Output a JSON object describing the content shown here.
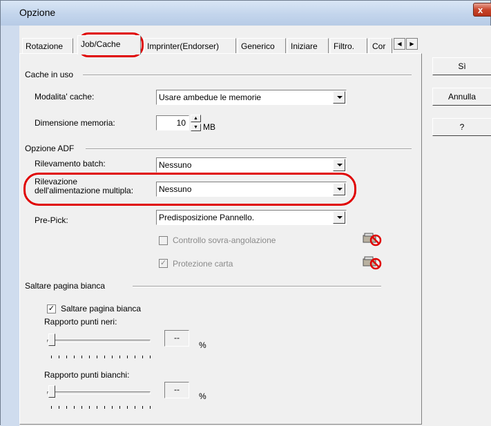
{
  "window": {
    "title": "Opzione",
    "close_label": "x"
  },
  "tabs": [
    {
      "label": "Rotazione"
    },
    {
      "label": "Job/Cache"
    },
    {
      "label": "Imprinter(Endorser)"
    },
    {
      "label": "Generico"
    },
    {
      "label": "Iniziare"
    },
    {
      "label": "Filtro."
    },
    {
      "label": "Cor"
    }
  ],
  "tab_scroll": {
    "left": "◀",
    "right": "▶"
  },
  "buttons": {
    "yes": "Sì",
    "cancel": "Annulla",
    "help": "?"
  },
  "cache": {
    "group_label": "Cache in uso",
    "mode_label": "Modalita' cache:",
    "mode_value": "Usare ambedue le memorie",
    "size_label": "Dimensione memoria:",
    "size_value": "10",
    "size_unit": "MB"
  },
  "adf": {
    "group_label": "Opzione ADF",
    "batch_label": "Rilevamento batch:",
    "batch_value": "Nessuno",
    "multifeed_label_1": "Rilevazione",
    "multifeed_label_2": "dell'alimentazione multipla:",
    "multifeed_value": "Nessuno",
    "prepick_label": "Pre-Pick:",
    "prepick_value": "Predisposizione Pannello.",
    "skew_label": "Controllo sovra-angolazione",
    "skew_checked": false,
    "paper_protect_label": "Protezione carta",
    "paper_protect_checked": true
  },
  "blank": {
    "group_label": "Saltare pagina bianca",
    "checkbox_label": "Saltare pagina bianca",
    "checked": true,
    "black_label": "Rapporto punti neri:",
    "black_value": "--",
    "black_unit": "%",
    "white_label": "Rapporto punti bianchi:",
    "white_value": "--",
    "white_unit": "%"
  },
  "colors": {
    "highlight_ring": "#e00000",
    "disabled_text": "#8a8a8a"
  }
}
